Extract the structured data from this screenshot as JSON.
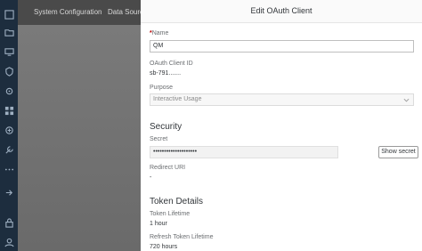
{
  "header": {
    "tabs": [
      "System Configuration",
      "Data Sources"
    ]
  },
  "rail": {
    "icons": [
      "dashboard-icon",
      "folder-icon",
      "monitor-icon",
      "shield-icon",
      "settings-icon",
      "grid-icon",
      "security-icon",
      "wrench-icon",
      "more-icon",
      "export-icon",
      "lock-icon",
      "user-icon"
    ]
  },
  "dialog": {
    "title": "Edit OAuth Client",
    "name_label": "Name",
    "name_required_marker": "*",
    "name_value": "QM",
    "client_id_label": "OAuth Client ID",
    "client_id_value": "sb-791.......",
    "purpose_label": "Purpose",
    "purpose_value": "Interactive Usage",
    "security_heading": "Security",
    "secret_label": "Secret",
    "secret_value": "••••••••••••••••••••",
    "show_secret_label": "Show secret",
    "redirect_uri_label": "Redirect URI",
    "redirect_uri_value": "-",
    "token_heading": "Token Details",
    "token_lifetime_label": "Token Lifetime",
    "token_lifetime_value": "1 hour",
    "refresh_lifetime_label": "Refresh Token Lifetime",
    "refresh_lifetime_value": "720 hours"
  },
  "colors": {
    "rail": "#1d2d3e",
    "overlay": "#707070",
    "required": "#bb0000"
  }
}
